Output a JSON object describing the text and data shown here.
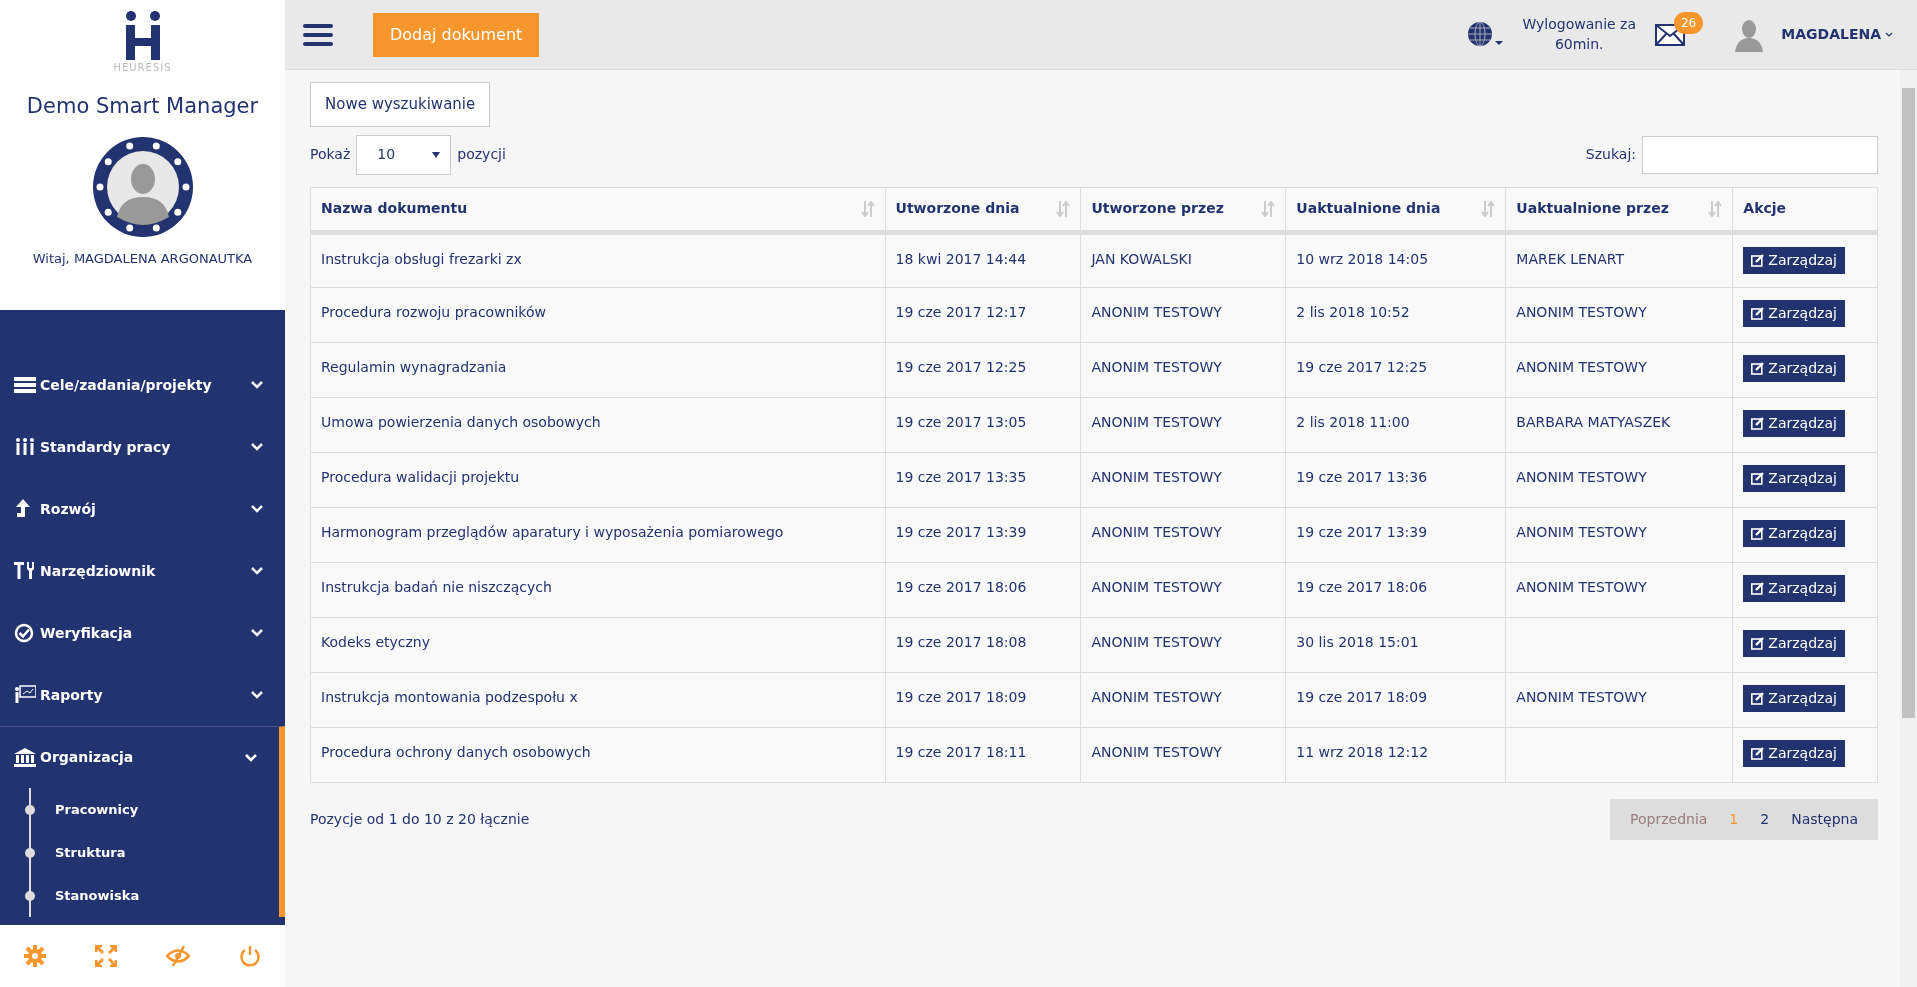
{
  "sidebar": {
    "logo_text": "HEURESIS",
    "app_title": "Demo Smart Manager",
    "greeting": "Witaj, MAGDALENA ARGONAUTKA",
    "menu": [
      {
        "label": "Cele/zadania/projekty",
        "expanded": false
      },
      {
        "label": "Standardy pracy",
        "expanded": false
      },
      {
        "label": "Rozwój",
        "expanded": false
      },
      {
        "label": "Narzędziownik",
        "expanded": false
      },
      {
        "label": "Weryfikacja",
        "expanded": false
      },
      {
        "label": "Raporty",
        "expanded": false
      },
      {
        "label": "Organizacja",
        "expanded": true,
        "children": [
          {
            "label": "Pracownicy"
          },
          {
            "label": "Struktura"
          },
          {
            "label": "Stanowiska"
          }
        ]
      }
    ]
  },
  "topbar": {
    "add_button": "Dodaj dokument",
    "logout_text": "Wylogowanie za 60min.",
    "mail_count": "26",
    "user_name": "MAGDALENA"
  },
  "toolbar": {
    "new_search_button": "Nowe wyszukiwanie",
    "show_label": "Pokaż",
    "page_size": "10",
    "show_suffix": "pozycji",
    "search_label": "Szukaj:"
  },
  "table": {
    "columns": [
      {
        "label": "Nazwa dokumentu",
        "sortable": true
      },
      {
        "label": "Utworzone dnia",
        "sortable": true
      },
      {
        "label": "Utworzone przez",
        "sortable": true
      },
      {
        "label": "Uaktualnione dnia",
        "sortable": true
      },
      {
        "label": "Uaktualnione przez",
        "sortable": true
      },
      {
        "label": "Akcje",
        "sortable": false
      }
    ],
    "rows": [
      {
        "cells": [
          "Instrukcja obsługi frezarki zx",
          "18 kwi 2017 14:44",
          "JAN KOWALSKI",
          "10 wrz 2018 14:05",
          "MAREK LENART"
        ],
        "action": "Zarządzaj"
      },
      {
        "cells": [
          "Procedura rozwoju pracowników",
          "19 cze 2017 12:17",
          "ANONIM TESTOWY",
          "2 lis 2018 10:52",
          "ANONIM TESTOWY"
        ],
        "action": "Zarządzaj"
      },
      {
        "cells": [
          "Regulamin wynagradzania",
          "19 cze 2017 12:25",
          "ANONIM TESTOWY",
          "19 cze 2017 12:25",
          "ANONIM TESTOWY"
        ],
        "action": "Zarządzaj"
      },
      {
        "cells": [
          "Umowa powierzenia danych osobowych",
          "19 cze 2017 13:05",
          "ANONIM TESTOWY",
          "2 lis 2018 11:00",
          "BARBARA MATYASZEK"
        ],
        "action": "Zarządzaj"
      },
      {
        "cells": [
          "Procedura walidacji projektu",
          "19 cze 2017 13:35",
          "ANONIM TESTOWY",
          "19 cze 2017 13:36",
          "ANONIM TESTOWY"
        ],
        "action": "Zarządzaj"
      },
      {
        "cells": [
          "Harmonogram przeglądów aparatury i wyposażenia pomiarowego",
          "19 cze 2017 13:39",
          "ANONIM TESTOWY",
          "19 cze 2017 13:39",
          "ANONIM TESTOWY"
        ],
        "action": "Zarządzaj"
      },
      {
        "cells": [
          "Instrukcja badań nie niszczących",
          "19 cze 2017 18:06",
          "ANONIM TESTOWY",
          "19 cze 2017 18:06",
          "ANONIM TESTOWY"
        ],
        "action": "Zarządzaj"
      },
      {
        "cells": [
          "Kodeks etyczny",
          "19 cze 2017 18:08",
          "ANONIM TESTOWY",
          "30 lis 2018 15:01",
          null
        ],
        "action": "Zarządzaj"
      },
      {
        "cells": [
          "Instrukcja montowania podzespołu x",
          "19 cze 2017 18:09",
          "ANONIM TESTOWY",
          "19 cze 2017 18:09",
          "ANONIM TESTOWY"
        ],
        "action": "Zarządzaj"
      },
      {
        "cells": [
          "Procedura ochrony danych osobowych",
          "19 cze 2017 18:11",
          "ANONIM TESTOWY",
          "11 wrz 2018 12:12",
          null
        ],
        "action": "Zarządzaj"
      }
    ]
  },
  "footer": {
    "info": "Pozycje od 1 do 10 z 20 łącznie",
    "pagination": [
      {
        "label": "Poprzednia",
        "selected": false,
        "disabled": true
      },
      {
        "label": "1",
        "selected": true,
        "disabled": false
      },
      {
        "label": "2",
        "selected": false,
        "disabled": false
      },
      {
        "label": "Następna",
        "selected": false,
        "disabled": false
      }
    ]
  }
}
